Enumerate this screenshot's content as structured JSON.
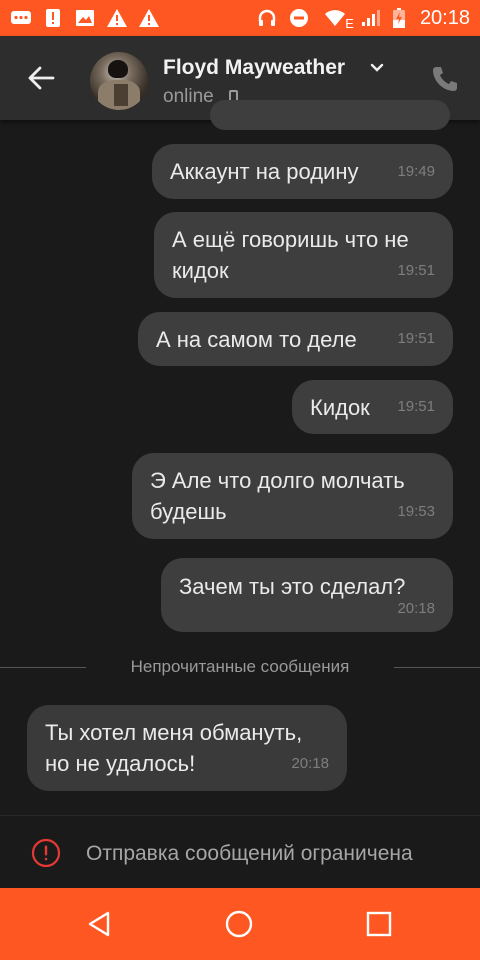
{
  "status_bar": {
    "time": "20:18",
    "network_label": "E",
    "left_icons": [
      "chat-icon",
      "alert-icon",
      "image-icon",
      "warning-icon",
      "warning-icon"
    ],
    "right_icons": [
      "headphones-icon",
      "do-not-disturb-icon",
      "wifi-icon",
      "signal-icon",
      "battery-charging-icon"
    ]
  },
  "header": {
    "contact_name": "Floyd Mayweather",
    "status": "online"
  },
  "messages": [
    {
      "text": "Аккаунт на родину",
      "time": "19:49",
      "direction": "out"
    },
    {
      "text_line1": "А ещё говоришь что не",
      "text_line2": "кидок",
      "time": "19:51",
      "direction": "out"
    },
    {
      "text": "А на самом то деле",
      "time": "19:51",
      "direction": "out"
    },
    {
      "text": "Кидок",
      "time": "19:51",
      "direction": "out"
    },
    {
      "text_line1": "Э Але что долго молчать",
      "text_line2": "будешь",
      "time": "19:53",
      "direction": "out"
    },
    {
      "text": "Зачем  ты это сделал?",
      "time": "20:18",
      "direction": "out"
    }
  ],
  "unread_divider": "Непрочитанные сообщения",
  "incoming": {
    "text_line1": "Ты хотел меня обмануть,",
    "text_line2": "но не удалось!",
    "time": "20:18"
  },
  "restriction": {
    "text": "Отправка сообщений ограничена"
  },
  "colors": {
    "accent": "#ff5722",
    "background": "#1a1a1a",
    "bubble": "#3e3e3e"
  }
}
